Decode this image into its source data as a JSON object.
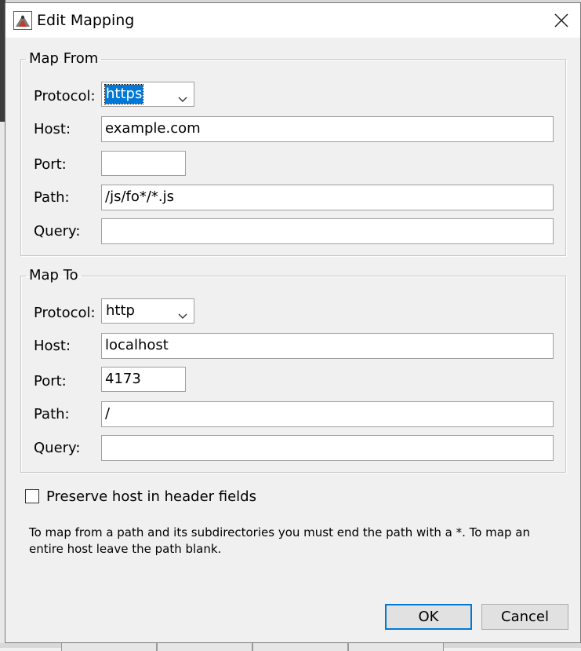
{
  "window": {
    "title": "Edit Mapping"
  },
  "map_from": {
    "legend": "Map From",
    "protocol_label": "Protocol:",
    "protocol_value": "https",
    "host_label": "Host:",
    "host_value": "example.com",
    "port_label": "Port:",
    "port_value": "",
    "path_label": "Path:",
    "path_value": "/js/fo*/*.js",
    "query_label": "Query:",
    "query_value": ""
  },
  "map_to": {
    "legend": "Map To",
    "protocol_label": "Protocol:",
    "protocol_value": "http",
    "host_label": "Host:",
    "host_value": "localhost",
    "port_label": "Port:",
    "port_value": "4173",
    "path_label": "Path:",
    "path_value": "/",
    "query_label": "Query:",
    "query_value": ""
  },
  "options": {
    "preserve_host_label": "Preserve host in header fields",
    "preserve_host_checked": false
  },
  "help_text": "To map from a path and its subdirectories you must end the path with a *. To map an entire host leave the path blank.",
  "buttons": {
    "ok": "OK",
    "cancel": "Cancel"
  },
  "colors": {
    "selection": "#0078d7",
    "default_button_border": "#0078d7"
  }
}
